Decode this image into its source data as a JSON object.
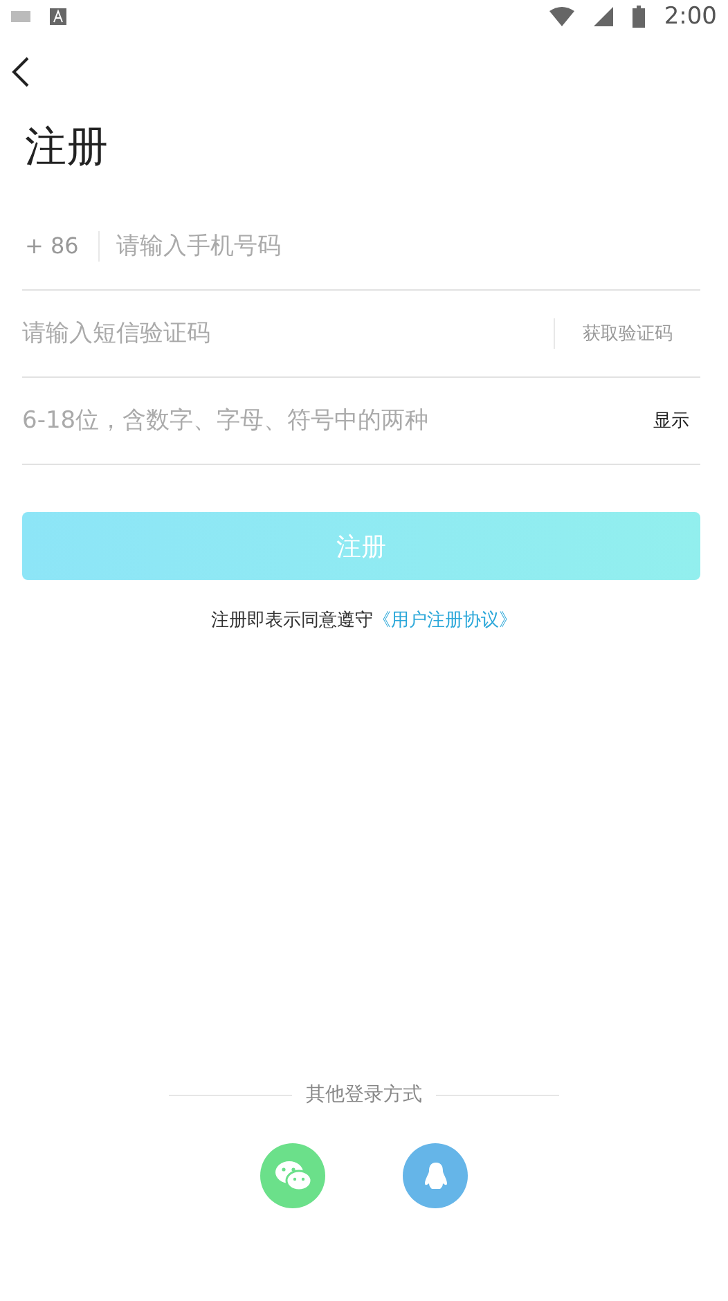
{
  "status_bar": {
    "time": "2:00"
  },
  "title": "注册",
  "phone": {
    "country_code": "+ 86",
    "placeholder": "请输入手机号码"
  },
  "sms_code": {
    "placeholder": "请输入短信验证码",
    "action": "获取验证码"
  },
  "password": {
    "placeholder": "6-18位，含数字、字母、符号中的两种",
    "toggle": "显示"
  },
  "submit": {
    "label": "注册",
    "disabled": true
  },
  "agreement": {
    "text": "注册即表示同意遵守",
    "link": "《用户注册协议》"
  },
  "other_login": {
    "label": "其他登录方式",
    "options": [
      {
        "kind": "wechat",
        "color": "#6be08a"
      },
      {
        "kind": "qq",
        "color": "#65b5e8"
      }
    ]
  }
}
